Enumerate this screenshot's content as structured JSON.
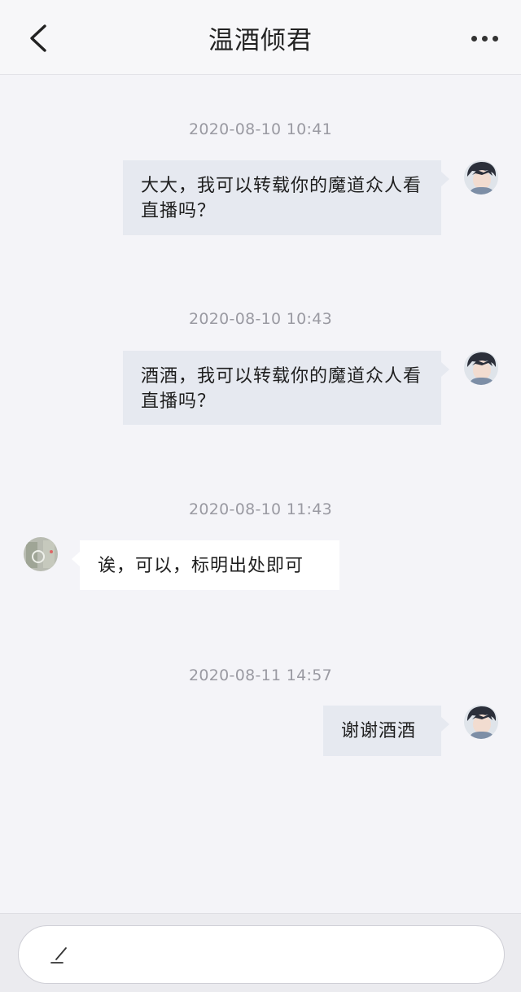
{
  "header": {
    "title": "温酒倾君",
    "back_icon": "chevron-left-icon",
    "more_icon": "more-horizontal-icon"
  },
  "messages": [
    {
      "timestamp": "2020-08-10 10:41",
      "sender": "me",
      "text": "大大，我可以转载你的魔道众人看直播吗？"
    },
    {
      "timestamp": "2020-08-10 10:43",
      "sender": "me",
      "text": "酒酒，我可以转载你的魔道众人看直播吗？"
    },
    {
      "timestamp": "2020-08-10 11:43",
      "sender": "them",
      "text": "诶，可以，标明出处即可"
    },
    {
      "timestamp": "2020-08-11 14:57",
      "sender": "me",
      "text": "谢谢酒酒"
    }
  ],
  "input": {
    "icon": "pen-icon",
    "value": ""
  },
  "colors": {
    "background": "#f4f4f8",
    "my_bubble": "#e6e9f0",
    "their_bubble": "#ffffff",
    "timestamp": "#9a9aa2"
  }
}
